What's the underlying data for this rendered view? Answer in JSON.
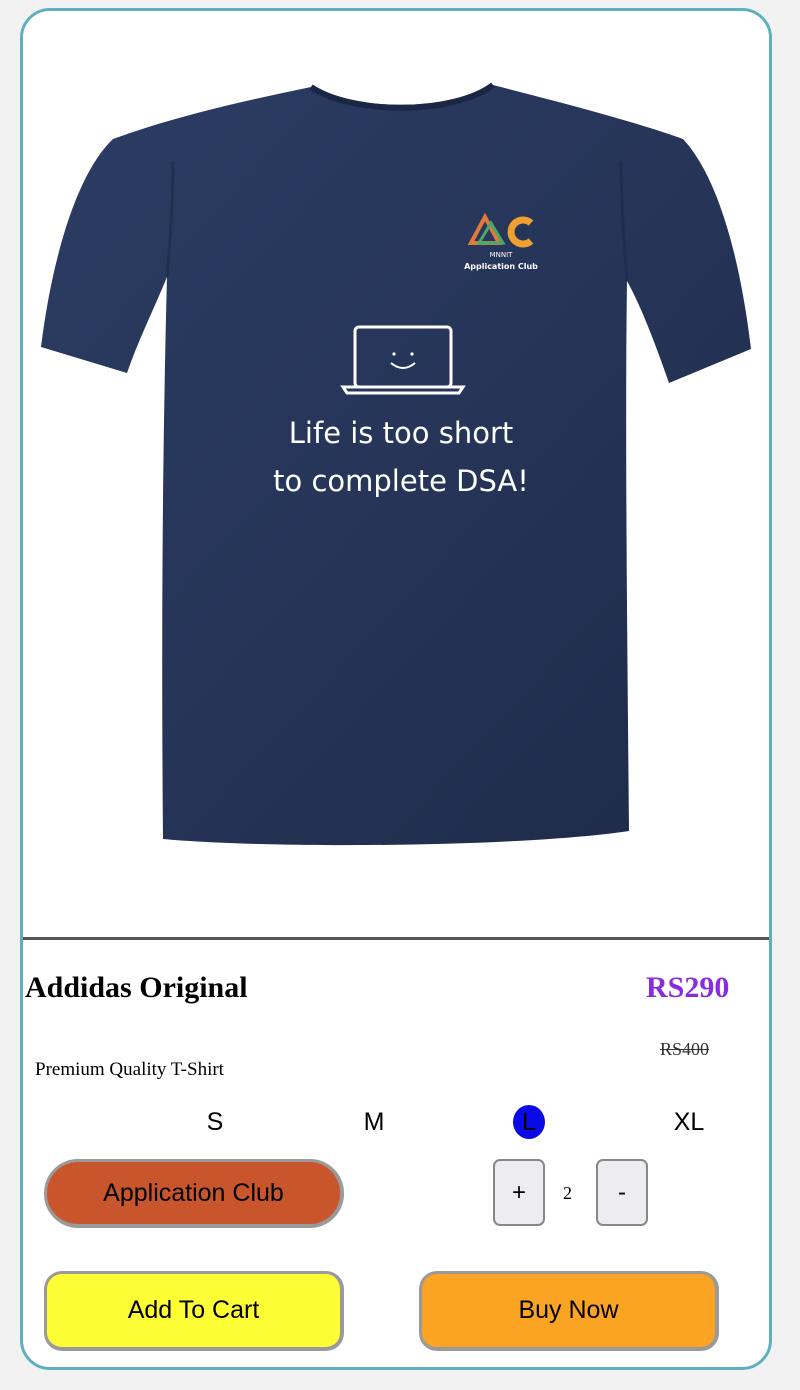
{
  "product": {
    "image_alt": "Navy blue t-shirt",
    "shirt_logo_brand": "MNNIT",
    "shirt_logo_sub": "Application Club",
    "shirt_print_line1": "Life is too short",
    "shirt_print_line2": "to complete DSA!",
    "name": "Addidas Original",
    "price": "RS290",
    "original_price": "RS400",
    "description": "Premium Quality T-Shirt"
  },
  "sizes": {
    "options": [
      "S",
      "M",
      "L",
      "XL"
    ],
    "selected": "L"
  },
  "actions": {
    "club_label": "Application Club",
    "add_to_cart_label": "Add To Cart",
    "buy_now_label": "Buy Now"
  },
  "quantity": {
    "increment_label": "+",
    "value": "2",
    "decrement_label": "-"
  },
  "colors": {
    "card_border": "#5fb0bf",
    "price": "#8a2be2",
    "size_selected": "#0a0ae6",
    "club_button": "#c9552d",
    "cart_button": "#fdfd36",
    "buy_button": "#fba322",
    "shirt": "#253457"
  }
}
